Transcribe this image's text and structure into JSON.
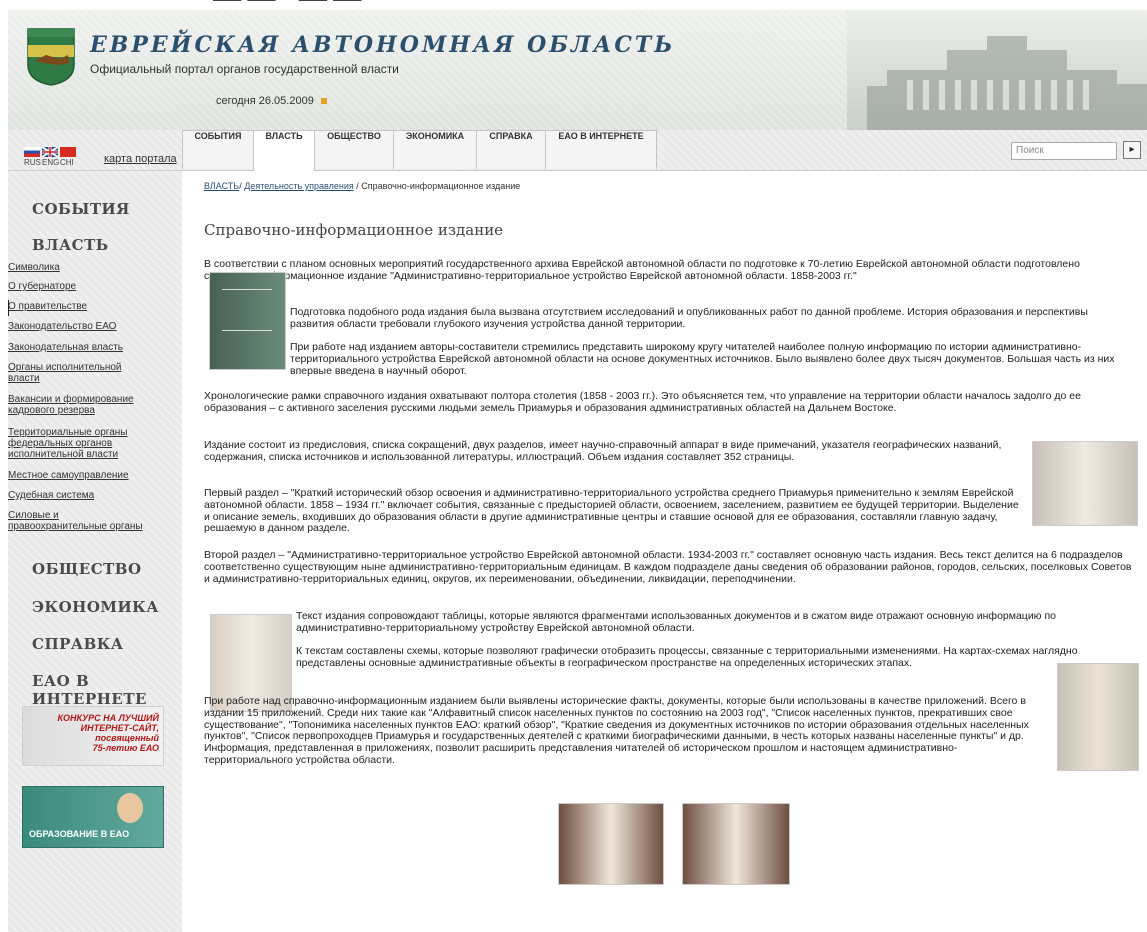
{
  "header": {
    "title": "ЕВРЕЙСКАЯ АВТОНОМНАЯ ОБЛАСТЬ",
    "subtitle": "Официальный портал органов государственной власти",
    "date_label": "сегодня 26.05.2009"
  },
  "top_left": {
    "languages": [
      "RUS",
      "ENG",
      "CHI"
    ],
    "map_link": "карта портала"
  },
  "tabs": [
    "СОБЫТИЯ",
    "ВЛАСТЬ",
    "ОБЩЕСТВО",
    "ЭКОНОМИКА",
    "СПРАВКА",
    "ЕАО В ИНТЕРНЕТЕ"
  ],
  "search": {
    "placeholder": "Поиск"
  },
  "sidebar": {
    "sections": [
      "СОБЫТИЯ",
      "ВЛАСТЬ",
      "ОБЩЕСТВО",
      "ЭКОНОМИКА",
      "СПРАВКА",
      "ЕАО В ИНТЕРНЕТЕ"
    ],
    "links": [
      {
        "lines": [
          "Символика"
        ]
      },
      {
        "lines": [
          "О губернаторе"
        ]
      },
      {
        "lines": [
          "О правительстве"
        ]
      },
      {
        "lines": [
          "Законодательство ЕАО"
        ]
      },
      {
        "lines": [
          "Законодательная власть"
        ]
      },
      {
        "lines": [
          "Органы исполнительной",
          "власти"
        ]
      },
      {
        "lines": [
          "Вакансии и формирование",
          "кадрового резерва"
        ]
      },
      {
        "lines": [
          "Территориальные органы",
          "федеральных органов",
          "исполнительной власти"
        ]
      },
      {
        "lines": [
          "Местное самоуправление"
        ]
      },
      {
        "lines": [
          "Судебная система"
        ]
      },
      {
        "lines": [
          "Силовые и",
          "правоохранительные органы"
        ]
      }
    ],
    "banner1_lines": [
      "КОНКУРС НА ЛУЧШИЙ",
      "ИНТЕРНЕТ-САЙТ,",
      "посвященный",
      "75-летию ЕАО"
    ],
    "banner2": "ОБРАЗОВАНИЕ В ЕАО"
  },
  "breadcrumb": {
    "level1": "ВЛАСТЬ",
    "sep1": "/ ",
    "level2": "Деятельность управления",
    "sep2": " / ",
    "current": "Справочно-информационное издание"
  },
  "article": {
    "title": "Справочно-информационное издание",
    "p1": "В соответствии с планом основных мероприятий государственного архива Еврейской автономной области по подготовке к 70-летию Еврейской автономной области подготовлено справочно-информационное издание \"Административно-территориальное устройство Еврейской автономной области. 1858-2003 гг.\"",
    "p2": "Подготовка подобного рода издания была вызвана отсутствием исследований и опубликованных работ по данной проблеме. История образования и перспективы развития области требовали глубокого изучения устройства данной территории.",
    "p3": "При работе над изданием авторы-составители стремились представить широкому кругу читателей наиболее полную информацию по истории административно-территориального устройства Еврейской автономной области на основе документных источников. Было выявлено более двух тысяч документов. Большая часть из них впервые введена в научный оборот.",
    "p4": "Хронологические рамки справочного издания охватывают полтора столетия (1858 - 2003 гг.). Это объясняется тем, что управление на территории области началось задолго до ее образования – с активного заселения русскими людьми земель Приамурья и образования административных областей на Дальнем Востоке.",
    "p5": "Издание состоит из предисловия, списка сокращений, двух разделов, имеет научно-справочный аппарат в виде примечаний, указателя географических названий, содержания, списка источников и использованной литературы, иллюстраций. Объем издания составляет 352 страницы.",
    "p6": "Первый раздел – \"Краткий исторический обзор освоения и административно-территориального устройства среднего Приамурья применительно к землям Еврейской автономной области. 1858 – 1934 гг.\" включает события, связанные с предысторией области, освоением, заселением, развитием ее будущей территории. Выделение и описание земель, входивших до образования области в другие административные центры и ставшие основой для ее образования, составляли главную задачу, решаемую в данном разделе.",
    "p7": "Второй раздел – \"Административно-территориальное устройство Еврейской автономной области. 1934-2003 гг.\" составляет основную часть издания. Весь текст делится на 6 подразделов соответственно существующим ныне административно-территориальным единицам. В каждом подразделе даны сведения об образовании районов, городов, сельских, поселковых Советов и административно-территориальных единиц, округов, их переименовании, объединении, ликвидации, переподчинении.",
    "p8": "Текст издания сопровождают таблицы, которые являются фрагментами использованных документов и в сжатом виде отражают основную информацию по административно-территориальному устройству Еврейской автономной области.",
    "p9": "К текстам составлены схемы, которые позволяют графически отобразить процессы, связанные с территориальными изменениями. На картах-схемах наглядно представлены основные административные объекты в географическом пространстве на определенных исторических этапах.",
    "p10": "При работе над справочно-информационным изданием были выявлены исторические факты, документы, которые были использованы в качестве приложений. Всего в издании 15 приложений. Среди них такие как \"Алфавитный список населенных пунктов по состоянию на 2003 год\", \"Список населенных пунктов, прекративших свое существование\", \"Топонимика населенных пунктов ЕАО: краткий обзор\", \"Краткие сведения из документных источников по истории образования отдельных населенных пунктов\", \"Список первопроходцев Приамурья и государственных деятелей с краткими биографическими данными, в честь которых названы населенные пункты\" и др. Информация, представленная в приложениях, позволит расширить представления читателей об историческом прошлом и настоящем административно-территориального устройства области."
  },
  "colors": {
    "title_blue": "#2d4f6e",
    "link_blue": "#2b4f74",
    "sidebar_bg": "#e9e9e9"
  }
}
